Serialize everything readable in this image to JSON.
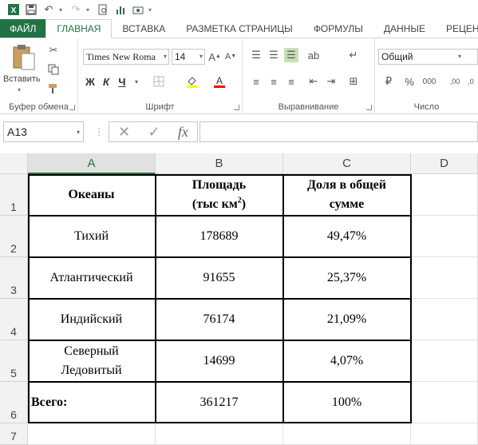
{
  "qat": {
    "icons": [
      "excel-logo-icon",
      "save-icon",
      "undo-icon",
      "redo-icon",
      "print-preview-icon",
      "chart-icon",
      "camera-icon"
    ]
  },
  "tabs": [
    "ФАЙЛ",
    "ГЛАВНАЯ",
    "ВСТАВКА",
    "РАЗМЕТКА СТРАНИЦЫ",
    "ФОРМУЛЫ",
    "ДАННЫЕ",
    "РЕЦЕНЗ"
  ],
  "ribbon": {
    "clipboard_group": "Буфер обмена",
    "paste_label": "Вставить",
    "font_group": "Шрифт",
    "font_name": "Times New Roma",
    "font_size": "14",
    "bold": "Ж",
    "italic": "К",
    "underline": "Ч",
    "alignment_group": "Выравнивание",
    "number_group": "Число",
    "number_format": "Общий"
  },
  "formula_bar": {
    "name_box": "A13",
    "fx": "fx",
    "formula": ""
  },
  "columns": [
    "A",
    "B",
    "C",
    "D"
  ],
  "rows": [
    "1",
    "2",
    "3",
    "4",
    "5",
    "6",
    "7"
  ],
  "table": {
    "header": {
      "ocean": "Океаны",
      "area_line1": "Площадь",
      "area_line2": "(тыс км",
      "area_sup": "2",
      "area_close": ")",
      "share_line1": "Доля в общей",
      "share_line2": "сумме"
    },
    "data": [
      {
        "ocean": "Тихий",
        "area": "178689",
        "share": "49,47%"
      },
      {
        "ocean": "Атлантический",
        "area": "91655",
        "share": "25,37%"
      },
      {
        "ocean": "Индийский",
        "area": "76174",
        "share": "21,09%"
      },
      {
        "ocean": "Северный Ледовитый",
        "ocean_line1": "Северный",
        "ocean_line2": "Ледовитый",
        "area": "14699",
        "share": "4,07%"
      }
    ],
    "total": {
      "label": "Всего:",
      "area": "361217",
      "share": "100%"
    }
  },
  "colors": {
    "accent": "#217346"
  }
}
